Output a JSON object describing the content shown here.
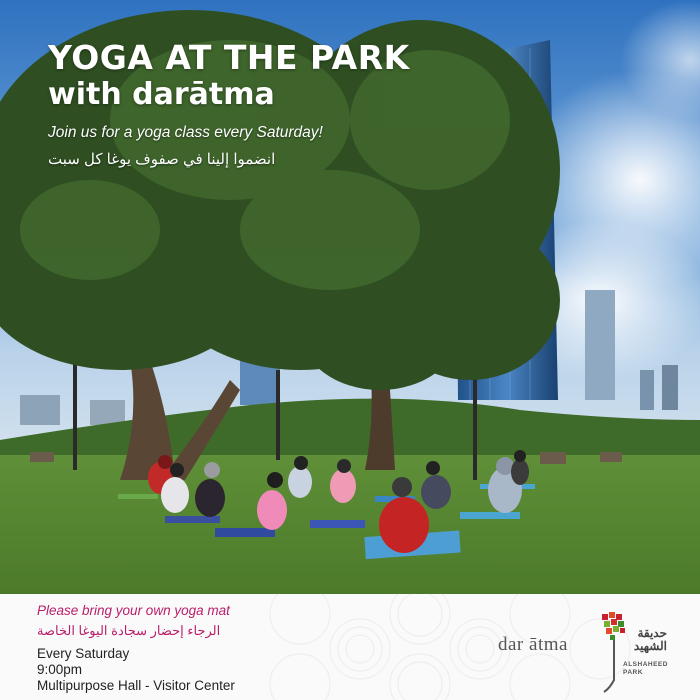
{
  "poster": {
    "title_line1": "YOGA AT THE PARK",
    "title_line2": "with darātma",
    "subtitle_en": "Join us for a yoga class every Saturday!",
    "subtitle_ar": "انضموا إلينا في صفوف يوغا كل سبت"
  },
  "footer": {
    "note_en": "Please bring your own yoga mat",
    "note_ar": "الرجاء إحضار سجادة اليوغا الخاصة",
    "schedule": "Every Saturday",
    "time": "9:00pm",
    "location": "Multipurpose Hall - Visitor Center",
    "brand": "dar ātma",
    "park_name_ar_line1": "حديقة",
    "park_name_ar_line2": "الشهيد",
    "park_name_en_line1": "ALSHAHEED",
    "park_name_en_line2": "PARK"
  },
  "colors": {
    "accent": "#b81e6a",
    "sky": "#3e7fc4",
    "grass": "#5b8a35"
  }
}
